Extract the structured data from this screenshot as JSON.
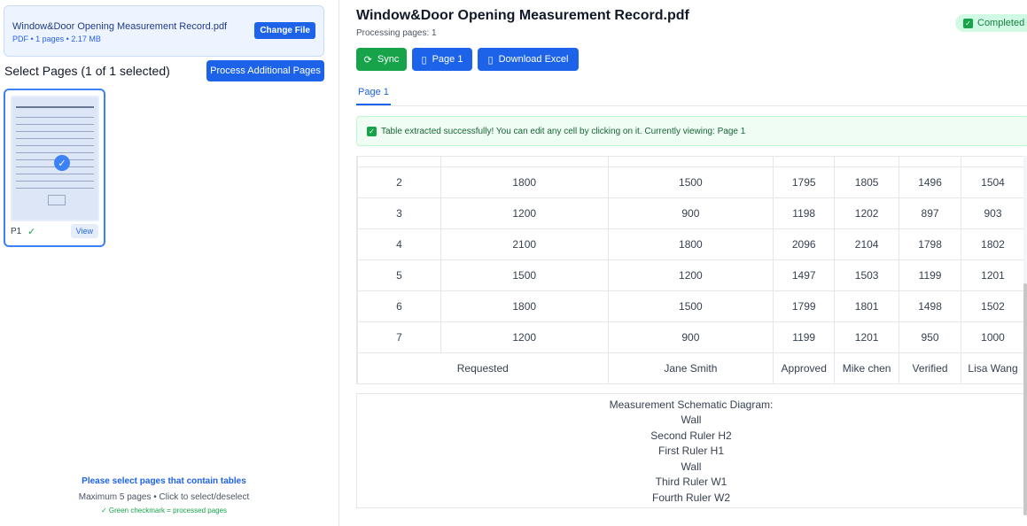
{
  "file": {
    "name": "Window&Door Opening Measurement Record.pdf",
    "meta": "PDF • 1 pages • 2.17 MB",
    "change_label": "Change File"
  },
  "select": {
    "title": "Select Pages (1 of 1 selected)",
    "process_label": "Process Additional Pages"
  },
  "thumbnail": {
    "page_label": "P1",
    "processed_mark": "✓",
    "view_label": "View"
  },
  "hints": {
    "line1": "Please select pages that contain tables",
    "line2": "Maximum 5 pages • Click to select/deselect",
    "line3": "✓ Green checkmark = processed pages"
  },
  "header": {
    "title": "Window&Door Opening Measurement Record.pdf",
    "processing": "Processing pages: 1",
    "status": "Completed"
  },
  "toolbar": {
    "sync_label": "Sync",
    "page_label": "Page 1",
    "excel_label": "Download Excel"
  },
  "tabs": [
    {
      "label": "Page 1"
    }
  ],
  "message": "Table extracted successfully! You can edit any cell by clicking on it.  Currently viewing: Page 1",
  "table": {
    "rows": [
      [
        "2",
        "1800",
        "1500",
        "1795",
        "1805",
        "1496",
        "1504"
      ],
      [
        "3",
        "1200",
        "900",
        "1198",
        "1202",
        "897",
        "903"
      ],
      [
        "4",
        "2100",
        "1800",
        "2096",
        "2104",
        "1798",
        "1802"
      ],
      [
        "5",
        "1500",
        "1200",
        "1497",
        "1503",
        "1199",
        "1201"
      ],
      [
        "6",
        "1800",
        "1500",
        "1799",
        "1801",
        "1498",
        "1502"
      ],
      [
        "7",
        "1200",
        "900",
        "1199",
        "1201",
        "950",
        "1000"
      ]
    ],
    "footer": [
      "Requested",
      "Jane Smith",
      "Approved",
      "Mike chen",
      "Verified",
      "Lisa Wang"
    ]
  },
  "schematic": {
    "lines": [
      "Measurement Schematic Diagram:",
      "Wall",
      "Second Ruler H2",
      "First Ruler H1",
      "Wall",
      "Third Ruler W1",
      "Fourth Ruler W2"
    ]
  },
  "colors": {
    "accent": "#1d63ea",
    "success": "#16a34a"
  }
}
